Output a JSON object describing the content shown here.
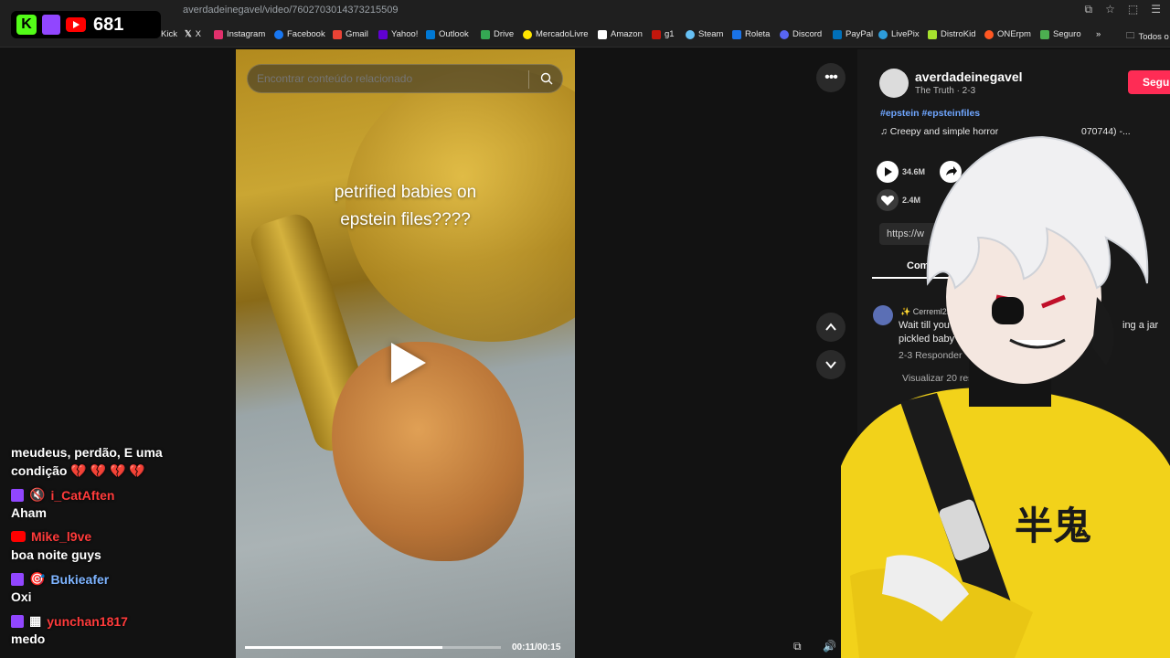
{
  "browser": {
    "url": "averdadeinegavel/video/7602703014373215509",
    "bookmarks": [
      {
        "label": "Kick",
        "color": "#53fc18"
      },
      {
        "label": "X",
        "color": "#ffffff"
      },
      {
        "label": "Instagram",
        "color": "#e1306c"
      },
      {
        "label": "Facebook",
        "color": "#1877f2"
      },
      {
        "label": "Gmail",
        "color": "#ea4335"
      },
      {
        "label": "Yahoo!",
        "color": "#6001d2"
      },
      {
        "label": "Outlook",
        "color": "#0078d4"
      },
      {
        "label": "Drive",
        "color": "#34a853"
      },
      {
        "label": "MercadoLivre",
        "color": "#ffe600"
      },
      {
        "label": "Amazon",
        "color": "#ffffff"
      },
      {
        "label": "g1",
        "color": "#c4170c"
      },
      {
        "label": "Steam",
        "color": "#66c0f4"
      },
      {
        "label": "Roleta",
        "color": "#1a73e8"
      },
      {
        "label": "Discord",
        "color": "#5865f2"
      },
      {
        "label": "PayPal",
        "color": "#0070ba"
      },
      {
        "label": "LivePix",
        "color": "#2d9cdb"
      },
      {
        "label": "DistroKid",
        "color": "#a6e22e"
      },
      {
        "label": "ONErpm",
        "color": "#ff5722"
      },
      {
        "label": "Seguro",
        "color": "#4caf50"
      }
    ],
    "more_bookmarks": "»",
    "all_bookmarks": "Todos o"
  },
  "counter": {
    "kick_letter": "K",
    "value": "681"
  },
  "chat": [
    {
      "platform": "none",
      "user": "",
      "message": "meudeus, perdão, E uma"
    },
    {
      "platform": "none",
      "user": "",
      "message": "condição 💔 💔 💔 💔"
    },
    {
      "platform": "twitch",
      "user": "i_CatAften",
      "user_color": "#ff3b3b",
      "message": "Aham"
    },
    {
      "platform": "youtube",
      "user": "Mike_l9ve",
      "user_color": "#ff3b3b",
      "message": "boa noite guys"
    },
    {
      "platform": "twitch",
      "user": "Bukieafer",
      "user_color": "#7eb4ff",
      "message": "Oxi"
    },
    {
      "platform": "twitch",
      "user": "yunchan1817",
      "user_color": "#ff3b3b",
      "message": "medo"
    }
  ],
  "video": {
    "search_placeholder": "Encontrar conteúdo relacionado",
    "caption_line1": "petrified babies on",
    "caption_line2": "epstein files????",
    "progress": 0.77,
    "timecode": "00:11/00:15"
  },
  "panel": {
    "username": "averdadeinegavel",
    "subline": "The Truth · 2-3",
    "follow_label": "Segui",
    "tags": "#epstein #epsteinfiles",
    "music": "♫  Creepy and simple horror",
    "music_tail": "070744) -...",
    "plays": "34.6M",
    "likes": "2.4M",
    "link": "https://w",
    "comments_tab": "Comen",
    "comment_user": "✨ Cerreml2nm",
    "comment_text": "Wait till you see t with a pickled baby",
    "comment_tail": "ing a jar",
    "comment_meta": "2-3   Responder",
    "view_replies": "Visualizar 20 respo"
  },
  "colors": {
    "accent": "#fe2c55",
    "kick": "#53fc18",
    "twitch": "#9146ff",
    "youtube": "#ff0000"
  }
}
